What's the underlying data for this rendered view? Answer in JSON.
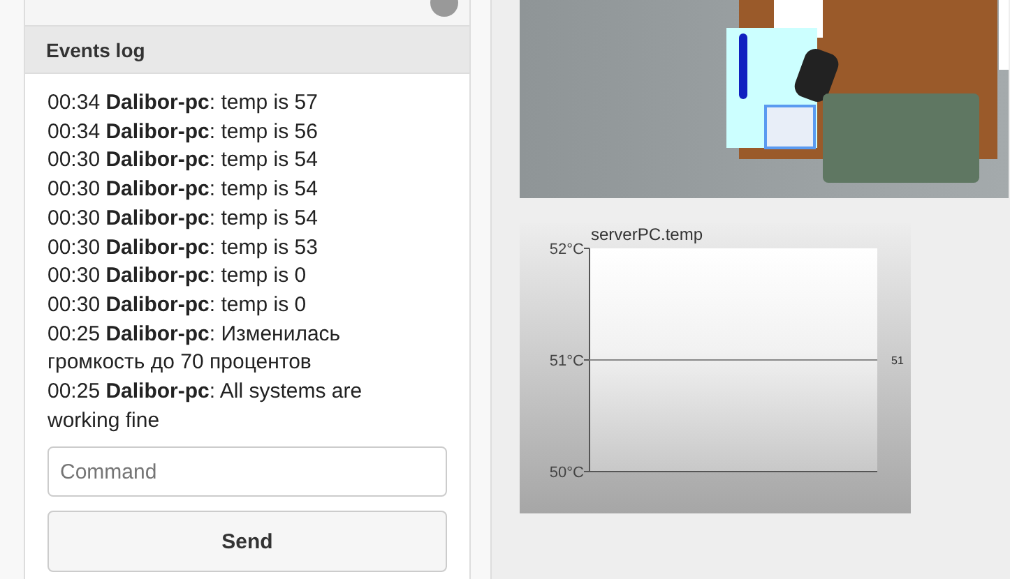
{
  "events_log": {
    "title": "Events log",
    "entries": [
      {
        "time": "00:34",
        "source": "Dalibor-pc",
        "message": ": temp is 57"
      },
      {
        "time": "00:34",
        "source": "Dalibor-pc",
        "message": ": temp is 56"
      },
      {
        "time": "00:30",
        "source": "Dalibor-pc",
        "message": ": temp is 54"
      },
      {
        "time": "00:30",
        "source": "Dalibor-pc",
        "message": ": temp is 54"
      },
      {
        "time": "00:30",
        "source": "Dalibor-pc",
        "message": ": temp is 54"
      },
      {
        "time": "00:30",
        "source": "Dalibor-pc",
        "message": ": temp is 53"
      },
      {
        "time": "00:30",
        "source": "Dalibor-pc",
        "message": ": temp is 0"
      },
      {
        "time": "00:30",
        "source": "Dalibor-pc",
        "message": ": temp is 0"
      },
      {
        "time": "00:25",
        "source": "Dalibor-pc",
        "message": ": Изменилась громкость до 70 процентов"
      },
      {
        "time": "00:25",
        "source": "Dalibor-pc",
        "message": ": All systems are working fine"
      }
    ],
    "command": {
      "placeholder": "Command"
    },
    "send_button": "Send"
  },
  "chart": {
    "title": "serverPC.temp",
    "y_labels": [
      "52°C",
      "51°C",
      "50°C"
    ],
    "line_label": "51"
  }
}
